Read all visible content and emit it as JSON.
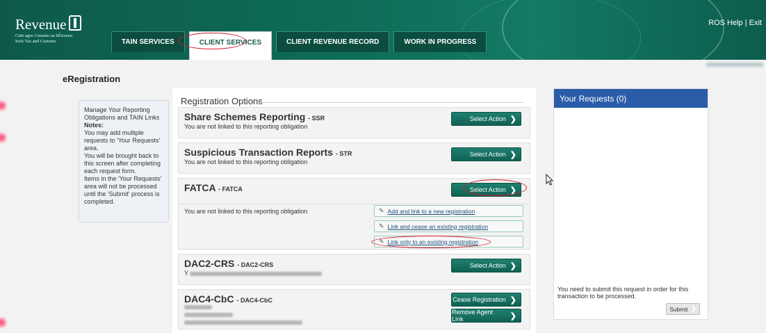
{
  "header": {
    "brand": "Revenue",
    "tagline1": "Cáin agus Custaim na hÉireann",
    "tagline2": "Irish Tax and Customs",
    "links": {
      "help": "ROS Help",
      "sep": "|",
      "exit": "Exit"
    },
    "tabs": [
      {
        "label": "TAIN SERVICES"
      },
      {
        "label": "CLIENT SERVICES"
      },
      {
        "label": "CLIENT REVENUE RECORD"
      },
      {
        "label": "WORK IN PROGRESS"
      }
    ],
    "active_tab": "CLIENT SERVICES"
  },
  "page": {
    "title": "eRegistration"
  },
  "notes": {
    "intro": "Manage Your Reporting Obligations and TAIN Links",
    "heading": "Notes:",
    "lines": [
      "You may add multiple requests to 'Your Requests' area.",
      "You will be brought back to this screen after completing each request form.",
      "Items in the 'Your Requests' area will not be processed until the 'Submit' process is completed."
    ]
  },
  "registration": {
    "title": "Registration Options",
    "items": [
      {
        "name": "Share Schemes Reporting",
        "code": "- SSR",
        "status": "You are not linked to this reporting obligation",
        "action": "Select Action"
      },
      {
        "name": "Suspicious Transaction Reports",
        "code": "- STR",
        "status": "You are not linked to this reporting obligation",
        "action": "Select Action"
      },
      {
        "name": "FATCA",
        "code": "- FATCA",
        "status": "You are not linked to this reporting obligation",
        "action": "Select Action",
        "options": [
          "Add and link to a new registration",
          "Link and cease an existing registration",
          "Link only to an existing registration"
        ]
      },
      {
        "name": "DAC2-CRS",
        "code": "- DAC2-CRS",
        "status_prefix": "Y",
        "action": "Select Action"
      },
      {
        "name": "DAC4-CbC",
        "code": "- DAC4-CbC",
        "actions": [
          "Cease Registration",
          "Remove Agent Link"
        ]
      }
    ]
  },
  "requests": {
    "title": "Your Requests (0)",
    "note": "You need to submit this request in order for this transaction to be processed.",
    "submit": "Submit"
  },
  "colors": {
    "header_green": "#0e5a4a",
    "button_green": "#1a7565",
    "requests_blue": "#2a5ca8",
    "highlight_red": "#d41c2a"
  },
  "icons": [
    "harp-logo-icon",
    "chevron-right-icon",
    "pencil-icon",
    "mouse-cursor-icon"
  ]
}
